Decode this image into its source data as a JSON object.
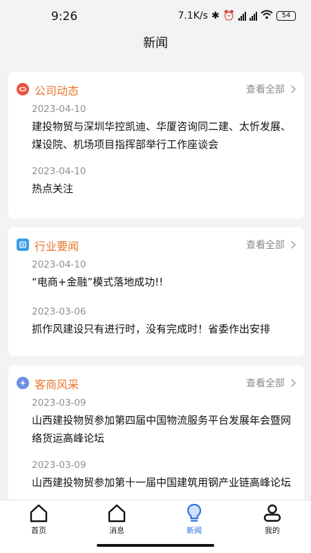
{
  "status_bar": {
    "time": "9:26",
    "network_speed": "7.1K/s",
    "battery": "54"
  },
  "header": {
    "title": "新闻"
  },
  "sections": [
    {
      "title": "公司动态",
      "view_all": "查看全部",
      "icon": "company-news-icon",
      "items": [
        {
          "date": "2023-04-10",
          "title": "建投物贸与深圳华控凯迪、华厦咨询同二建、太忻发展、煤设院、机场项目指挥部举行工作座谈会"
        },
        {
          "date": "2023-04-10",
          "title": "热点关注"
        }
      ]
    },
    {
      "title": "行业要闻",
      "view_all": "查看全部",
      "icon": "industry-news-icon",
      "items": [
        {
          "date": "2023-04-10",
          "title": "“电商+金融”模式落地成功!!"
        },
        {
          "date": "2023-03-06",
          "title": "抓作风建设只有进行时，没有完成时！省委作出安排"
        }
      ]
    },
    {
      "title": "客商风采",
      "view_all": "查看全部",
      "icon": "merchant-style-icon",
      "items": [
        {
          "date": "2023-03-09",
          "title": "山西建投物贸参加第四届中国物流服务平台发展年会暨网络货运高峰论坛"
        },
        {
          "date": "2023-03-09",
          "title": "山西建投物贸参加第十一届中国建筑用钢产业链高峰论坛"
        }
      ]
    }
  ],
  "tabs": [
    {
      "label": "首页",
      "icon": "home-icon"
    },
    {
      "label": "消息",
      "icon": "message-icon"
    },
    {
      "label": "新闻",
      "icon": "news-bulb-icon",
      "active": true
    },
    {
      "label": "我的",
      "icon": "profile-icon"
    }
  ],
  "colors": {
    "accent_orange": "#e8762c",
    "active_blue": "#2f6fe0",
    "background": "#f2f3f5"
  }
}
